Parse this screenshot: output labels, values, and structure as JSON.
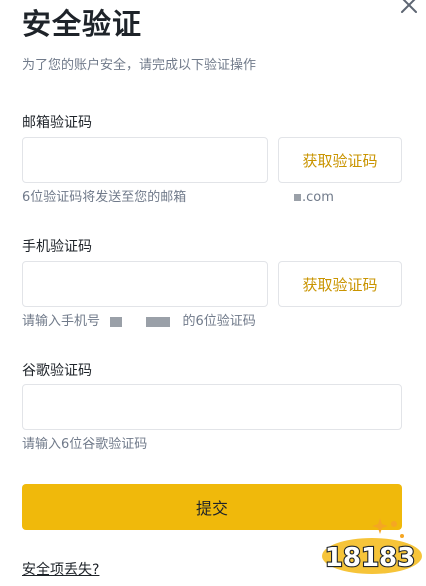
{
  "dialog": {
    "title": "安全验证",
    "subtitle": "为了您的账户安全，请完成以下验证操作",
    "close_icon": "close-icon"
  },
  "email": {
    "label": "邮箱验证码",
    "value": "",
    "button_label": "获取验证码",
    "hint": "6位验证码将发送至您的邮箱",
    "masked_email_suffix": ".com"
  },
  "phone": {
    "label": "手机验证码",
    "value": "",
    "button_label": "获取验证码",
    "hint_prefix": "请输入手机号",
    "hint_suffix": "的6位验证码"
  },
  "google": {
    "label": "谷歌验证码",
    "value": "",
    "hint": "请输入6位谷歌验证码"
  },
  "submit_label": "提交",
  "lost_link": "安全项丢失?",
  "colors": {
    "accent": "#F0B90B",
    "link_gold": "#C99400",
    "text_primary": "#1E2329",
    "text_secondary": "#707A8A",
    "border": "#E2E4E8"
  },
  "watermark": {
    "brand_text": "18183"
  }
}
